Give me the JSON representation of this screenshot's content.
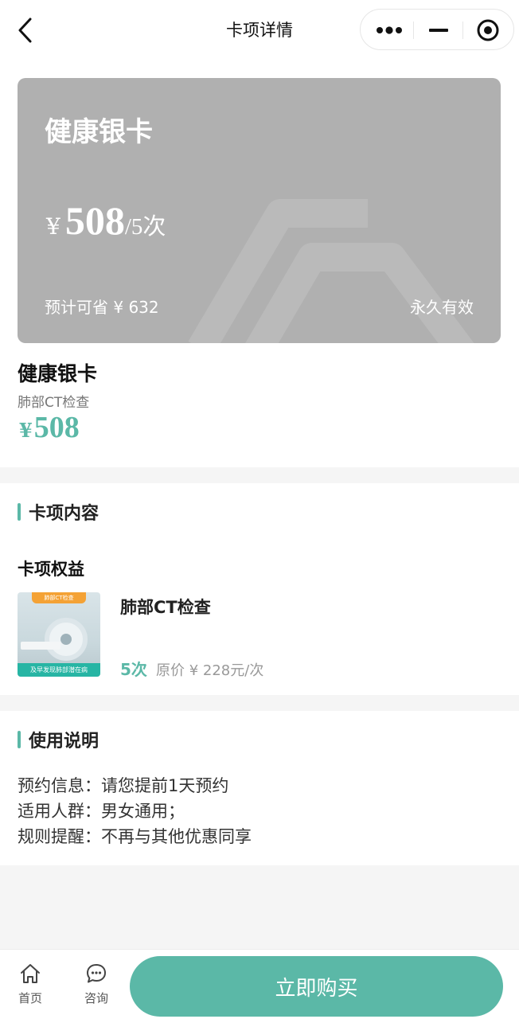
{
  "header": {
    "title": "卡项详情"
  },
  "card": {
    "name": "健康银卡",
    "currency": "¥",
    "price": "508",
    "unit": "/5次",
    "savings": "预计可省 ¥ 632",
    "validity": "永久有效",
    "color": "#b0b0b0"
  },
  "product": {
    "name": "健康银卡",
    "subtitle": "肺部CT检查",
    "currency": "¥",
    "price": "508"
  },
  "card_content": {
    "title": "卡项内容",
    "benefits_label": "卡项权益",
    "items": [
      {
        "name": "肺部CT检查",
        "count": "5次",
        "original_price": "原价 ¥ 228元/次",
        "image_tag": "肺部CT检查",
        "image_caption": "及早发现肺部潜在病"
      }
    ]
  },
  "usage": {
    "title": "使用说明",
    "lines": [
      "预约信息：请您提前1天预约",
      "适用人群：男女通用；",
      "规则提醒：不再与其他优惠同享"
    ]
  },
  "bottom_bar": {
    "home_label": "首页",
    "consult_label": "咨询",
    "buy_label": "立即购买"
  },
  "colors": {
    "accent": "#5bb8a7",
    "card_bg": "#b0b0b0",
    "page_bg": "#f5f5f5"
  }
}
